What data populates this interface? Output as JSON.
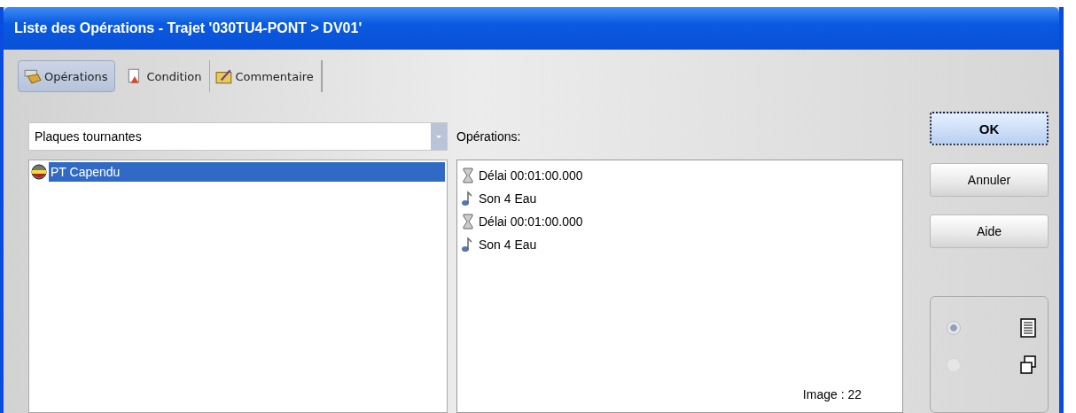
{
  "window": {
    "title": "Liste des Opérations - Trajet '030TU4-PONT > DV01'"
  },
  "tabs": [
    {
      "label": "Opérations",
      "kind": "operations",
      "selected": true
    },
    {
      "label": "Condition",
      "kind": "condition",
      "selected": false
    },
    {
      "label": "Commentaire",
      "kind": "comment",
      "selected": false
    }
  ],
  "category_dropdown": {
    "value": "Plaques tournantes"
  },
  "items": [
    {
      "label": "PT Capendu",
      "selected": true
    }
  ],
  "operations": {
    "label": "Opérations:",
    "items": [
      {
        "kind": "delay",
        "text": "Délai 00:01:00.000"
      },
      {
        "kind": "sound",
        "text": "Son 4 Eau"
      },
      {
        "kind": "delay",
        "text": "Délai 00:01:00.000"
      },
      {
        "kind": "sound",
        "text": "Son 4 Eau"
      }
    ],
    "image_count": "Image : 22"
  },
  "buttons": [
    {
      "label": "OK",
      "default": true
    },
    {
      "label": "Annuler",
      "default": false
    },
    {
      "label": "Aide",
      "default": false
    }
  ],
  "view_options": [
    {
      "kind": "list",
      "selected": true
    },
    {
      "kind": "windows",
      "selected": false
    }
  ]
}
